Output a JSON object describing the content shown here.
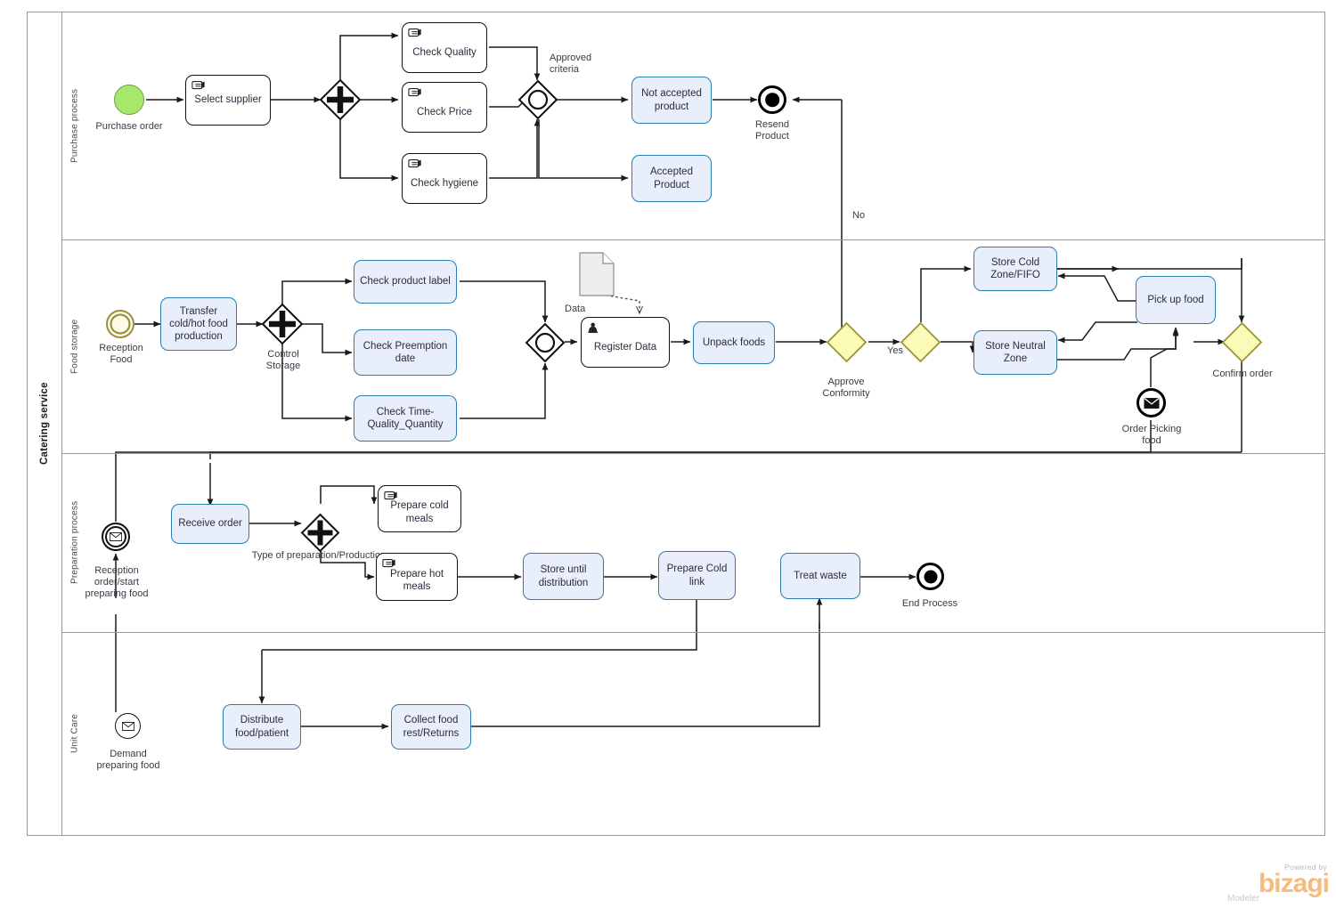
{
  "pool": {
    "label": "Catering service"
  },
  "lanes": [
    {
      "id": "purchase",
      "label": "Purchase process"
    },
    {
      "id": "storage",
      "label": "Food storage"
    },
    {
      "id": "preparation",
      "label": "Preparation process"
    },
    {
      "id": "unitcare",
      "label": "Unit Care"
    }
  ],
  "colors": {
    "task_fill": "#e9eefb",
    "task_border": "#2b7cad",
    "gateway_fill": "#fbfbb8",
    "gateway_border": "#9a9335",
    "start_event_fill": "#a5e86b",
    "lane_border": "#9a9a9a",
    "flow_stroke": "#1a1a1a",
    "brand_orange": "#f5bc7b"
  },
  "tasks": {
    "select_supplier": "Select supplier",
    "check_quality": "Check Quality",
    "check_price": "Check Price",
    "check_hygiene": "Check hygiene",
    "not_accepted": "Not accepted\nproduct",
    "accepted": "Accepted\nProduct",
    "transfer_food": "Transfer\ncold/hot food\nproduction",
    "check_label": "Check product label",
    "check_preemption": "Check Preemption\ndate",
    "check_time": "Check  Time-\nQuality_Quantity",
    "register_data": "Register Data",
    "unpack_foods": "Unpack foods",
    "store_cold": "Store Cold\nZone/FIFO",
    "store_neutral": "Store Neutral\nZone",
    "pick_up_food": "Pick up food",
    "receive_order": "Receive order",
    "prepare_cold": "Prepare cold\nmeals",
    "prepare_hot": "Prepare hot\nmeals",
    "store_until": "Store until\ndistribution",
    "prepare_cold_link": "Prepare Cold\nlink",
    "treat_waste": "Treat waste",
    "distribute_food": "Distribute\nfood/patient",
    "collect_food": "Collect food\nrest/Returns"
  },
  "events": {
    "purchase_order": "Purchase order",
    "resend_product": "Resend\nProduct",
    "reception_food": "Reception\nFood",
    "order_picking": "Order Picking\nfood",
    "reception_order": "Reception\norder/start\npreparing food",
    "end_process": "End Process",
    "demand_preparing": "Demand\npreparing food"
  },
  "gateway_labels": {
    "control_storage": "Control\nStorage",
    "approved_criteria": "Approved\ncriteria",
    "approve_conformity": "Approve\nConformity",
    "confirm_order": "Confirm order",
    "type_of_preparation": "Type of preparation/Production"
  },
  "flow_labels": {
    "no": "No",
    "yes": "Yes"
  },
  "artifacts": {
    "data_object": "Data"
  },
  "branding": {
    "powered_by": "Powered by",
    "wordmark": "bizagi",
    "product": "Modeler"
  }
}
